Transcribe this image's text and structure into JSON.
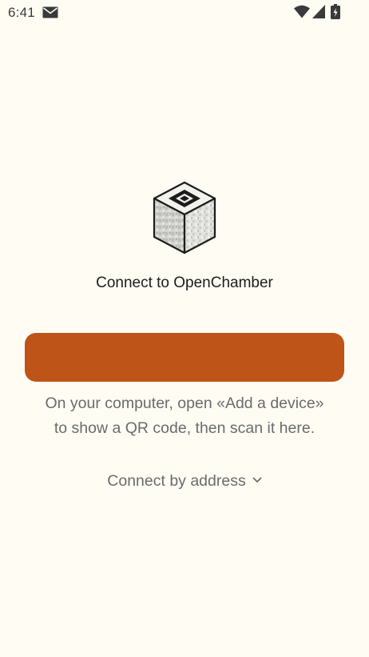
{
  "status_bar": {
    "time": "6:41",
    "icons": [
      "mail-icon",
      "wifi-icon",
      "signal-icon",
      "battery-icon"
    ]
  },
  "main": {
    "logo": "openchamber-cube-logo",
    "title": "Connect to OpenChamber",
    "scan_button_label": "",
    "hint_line1": "On your computer, open «Add a device»",
    "hint_line2": "to show a QR code, then scan it here.",
    "address_toggle_label": "Connect by address",
    "address_toggle_icon": "chevron-down-icon"
  },
  "colors": {
    "background": "#FFFCF4",
    "accent": "#BF5418",
    "text_primary": "#1C1C1C",
    "text_secondary": "#6B6B6B"
  }
}
